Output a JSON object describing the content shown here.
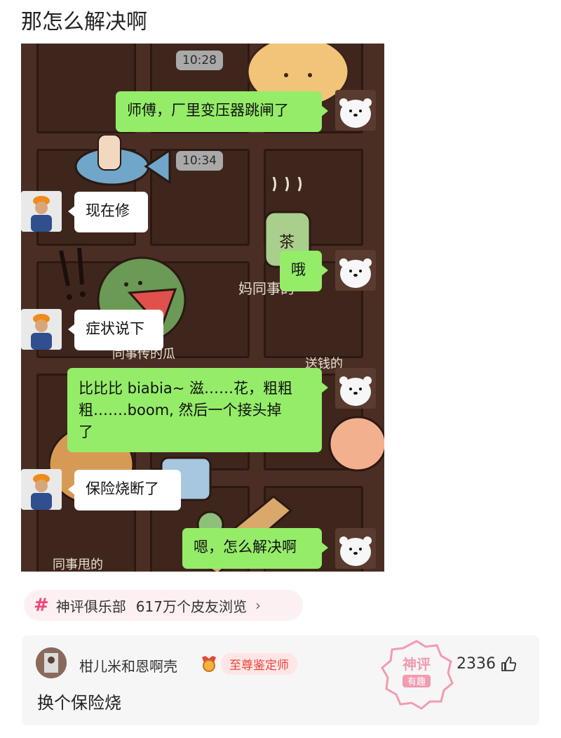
{
  "post": {
    "title": "那怎么解决啊"
  },
  "chat": {
    "messages": [
      {
        "type": "time",
        "text": "10:28"
      },
      {
        "type": "sent",
        "text": "师傅，厂里变压器跳闸了"
      },
      {
        "type": "time",
        "text": "10:34"
      },
      {
        "type": "received",
        "text": "现在修"
      },
      {
        "type": "sent",
        "text": "哦"
      },
      {
        "type": "received",
        "text": "症状说下"
      },
      {
        "type": "sent",
        "line1": "比比比 biabia~ 滋……花，粗粗",
        "line2": "粗…….boom, 然后一个接头掉",
        "line3": "了"
      },
      {
        "type": "received",
        "text": "保险烧断了"
      },
      {
        "type": "sent",
        "text": "嗯，怎么解决啊"
      }
    ],
    "wallpaper_text": [
      "茶",
      "妈同事的",
      "同事传的瓜",
      "送钱的",
      "同事甩的"
    ]
  },
  "topic": {
    "icon": "hashtag-icon",
    "name": "神评俱乐部",
    "views": "617万个皮友浏览",
    "chevron": "›"
  },
  "comment": {
    "username": "柑儿米和恩啊壳",
    "badge": "至尊鉴定师",
    "text": "换个保险烧",
    "likes": "2336",
    "stamp": {
      "line1": "神评",
      "line2": "有趣"
    }
  },
  "colors": {
    "sent_bubble": "#95ec69",
    "received_bubble": "#ffffff",
    "chat_bg": "#4a2e24",
    "accent": "#f0467a",
    "badge_red": "#e8453c"
  }
}
